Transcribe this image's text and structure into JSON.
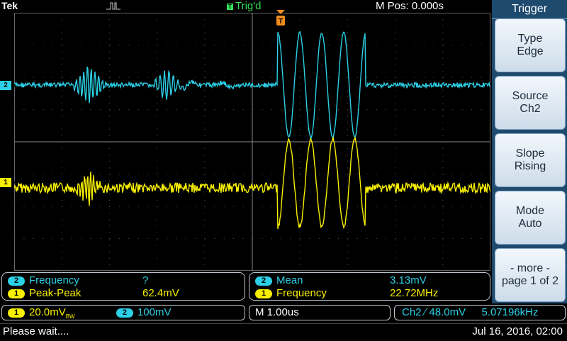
{
  "topbar": {
    "brand": "Tek",
    "trigger_status": "Trig'd",
    "trigger_status_glyph": "T",
    "mpos": "M Pos: 0.000s"
  },
  "markers": {
    "ch2": "2",
    "ch1": "1",
    "trigger_glyph": "T"
  },
  "menu": {
    "title": "Trigger",
    "buttons": [
      {
        "line1": "Type",
        "line2": "Edge"
      },
      {
        "line1": "Source",
        "line2": "Ch2"
      },
      {
        "line1": "Slope",
        "line2": "Rising"
      },
      {
        "line1": "Mode",
        "line2": "Auto"
      },
      {
        "line1": "- more -",
        "line2": "page 1 of 2"
      }
    ]
  },
  "measurements": {
    "left": [
      {
        "channel": "2",
        "label": "Frequency",
        "value": "?"
      },
      {
        "channel": "1",
        "label": "Peak-Peak",
        "value": "62.4mV"
      }
    ],
    "right": [
      {
        "channel": "2",
        "label": "Mean",
        "value": "3.13mV"
      },
      {
        "channel": "1",
        "label": "Frequency",
        "value": "22.72MHz"
      }
    ]
  },
  "status": {
    "ch1_badge": "1",
    "ch1_scale": "20.0mV",
    "ch1_bw": "BW",
    "ch2_badge": "2",
    "ch2_scale": "100mV",
    "timebase": "M 1.00us",
    "trig_source": "Ch2",
    "trig_slope_glyph": "∕",
    "trig_level": "48.0mV",
    "trig_freq": "5.07196kHz"
  },
  "message": {
    "text": "Please wait....",
    "datetime": "Jul 16, 2016, 02:00"
  },
  "colors": {
    "ch1": "#f8f000",
    "ch2": "#2cd0e6",
    "trig_status": "#36e05a",
    "menu_bg": "#1e4a6e"
  }
}
